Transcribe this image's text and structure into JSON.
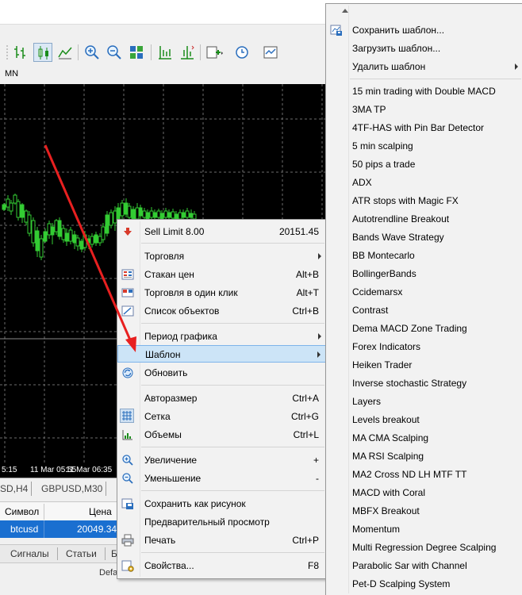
{
  "toolbar": {
    "icons": [
      "bar-chart-icon",
      "candles-icon",
      "line-chart-icon",
      "zoom-in-icon",
      "zoom-out-icon",
      "tile-windows-icon",
      "scroll-chart-icon",
      "chart-shift-icon",
      "indicators-icon",
      "periods-icon",
      "templates-icon"
    ]
  },
  "period_bar": {
    "current": "MN"
  },
  "chart": {
    "times": [
      "5:15",
      "11 Mar 05:55",
      "11 Mar 06:35"
    ],
    "colors": {
      "background": "#000000",
      "grid": "#6b6b6b",
      "candle": "#33cc33"
    }
  },
  "chart_tabs": [
    "SD,H4",
    "GBPUSD,M30"
  ],
  "market_watch": {
    "columns": [
      "Символ",
      "Цена"
    ],
    "row": {
      "symbol": "btcusd",
      "price": "20049.34"
    }
  },
  "bottom_tabs": [
    "Сигналы",
    "Статьи",
    "Б"
  ],
  "bottom_default": "Defa",
  "context_menu": {
    "sell_limit": {
      "label": "Sell Limit 8.00",
      "value": "20151.45"
    },
    "trading": "Торговля",
    "depth": {
      "label": "Стакан цен",
      "shortcut": "Alt+B"
    },
    "one_click": {
      "label": "Торговля в один клик",
      "shortcut": "Alt+T"
    },
    "objects": {
      "label": "Список объектов",
      "shortcut": "Ctrl+B"
    },
    "period": "Период графика",
    "template": "Шаблон",
    "refresh": "Обновить",
    "autosize": {
      "label": "Авторазмер",
      "shortcut": "Ctrl+A"
    },
    "grid": {
      "label": "Сетка",
      "shortcut": "Ctrl+G"
    },
    "volumes": {
      "label": "Объемы",
      "shortcut": "Ctrl+L"
    },
    "zoom_in": {
      "label": "Увеличение",
      "shortcut": "+"
    },
    "zoom_out": {
      "label": "Уменьшение",
      "shortcut": "-"
    },
    "save_picture": "Сохранить как рисунок",
    "preview": "Предварительный просмотр",
    "print": {
      "label": "Печать",
      "shortcut": "Ctrl+P"
    },
    "properties": {
      "label": "Свойства...",
      "shortcut": "F8"
    }
  },
  "template_menu": {
    "save": "Сохранить шаблон...",
    "load": "Загрузить шаблон...",
    "delete": "Удалить шаблон",
    "templates": [
      "15 min trading with Double MACD",
      "3MA TP",
      "4TF-HAS with Pin Bar Detector",
      "5 min scalping",
      "50 pips a trade",
      "ADX",
      "ATR stops with Magic FX",
      "Autotrendline Breakout",
      "Bands Wave Strategy",
      "BB Montecarlo",
      "BollingerBands",
      "Ccidemarsx",
      "Contrast",
      "Dema MACD Zone Trading",
      "Forex Indicators",
      "Heiken Trader",
      "Inverse stochastic Strategy",
      "Layers",
      "Levels breakout",
      "MA CMA Scalping",
      "MA RSI Scalping",
      "MA2 Cross ND LH MTF TT",
      "MACD with Coral",
      "MBFX Breakout",
      "Momentum",
      "Multi Regression Degree Scalping",
      "Parabolic Sar with Channel",
      "Pet-D Scalping System"
    ]
  },
  "colors": {
    "highlight": "#cce4f7",
    "arrow": "#e82020",
    "selected_row": "#1a6fd0"
  }
}
